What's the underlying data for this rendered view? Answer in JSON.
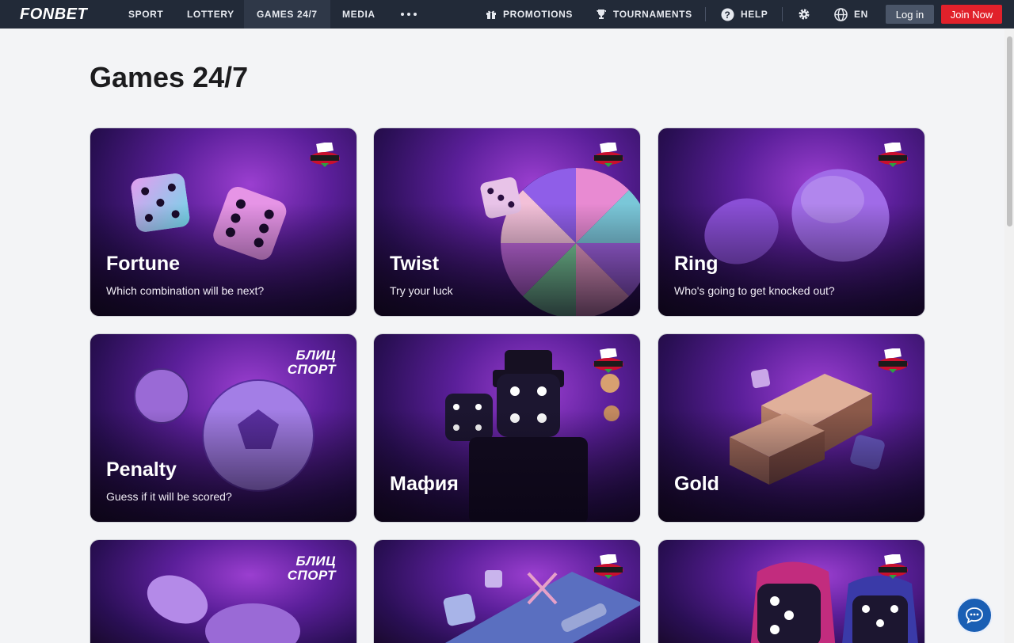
{
  "header": {
    "logo": "FONBET",
    "nav": [
      "SPORT",
      "LOTTERY",
      "GAMES 24/7",
      "MEDIA"
    ],
    "promotions": "PROMOTIONS",
    "tournaments": "TOURNAMENTS",
    "help": "HELP",
    "language": "EN",
    "login": "Log in",
    "join": "Join Now"
  },
  "page": {
    "title": "Games 24/7"
  },
  "games": [
    {
      "title": "Fortune",
      "subtitle": "Which combination will be next?",
      "badge": "NARDBALL"
    },
    {
      "title": "Twist",
      "subtitle": "Try your luck",
      "badge": "NARDBALL"
    },
    {
      "title": "Ring",
      "subtitle": "Who's going to get knocked out?",
      "badge": "NARDBALL"
    },
    {
      "title": "Penalty",
      "subtitle": "Guess if it will be scored?",
      "badge": "БЛИЦ СПОРТ"
    },
    {
      "title": "Мафия",
      "subtitle": "",
      "badge": "NARDBALL"
    },
    {
      "title": "Gold",
      "subtitle": "",
      "badge": "NARDBALL"
    },
    {
      "title": "",
      "subtitle": "",
      "badge": "БЛИЦ СПОРТ"
    },
    {
      "title": "",
      "subtitle": "",
      "badge": "NARDBALL"
    },
    {
      "title": "",
      "subtitle": "",
      "badge": "NARDBALL"
    }
  ],
  "blitz_line1": "БЛИЦ",
  "blitz_line2": "СПОРТ",
  "colors": {
    "nav_bg": "#222a38",
    "join": "#e1212b",
    "chat": "#1a5fb4",
    "page_bg": "#f3f4f6"
  }
}
